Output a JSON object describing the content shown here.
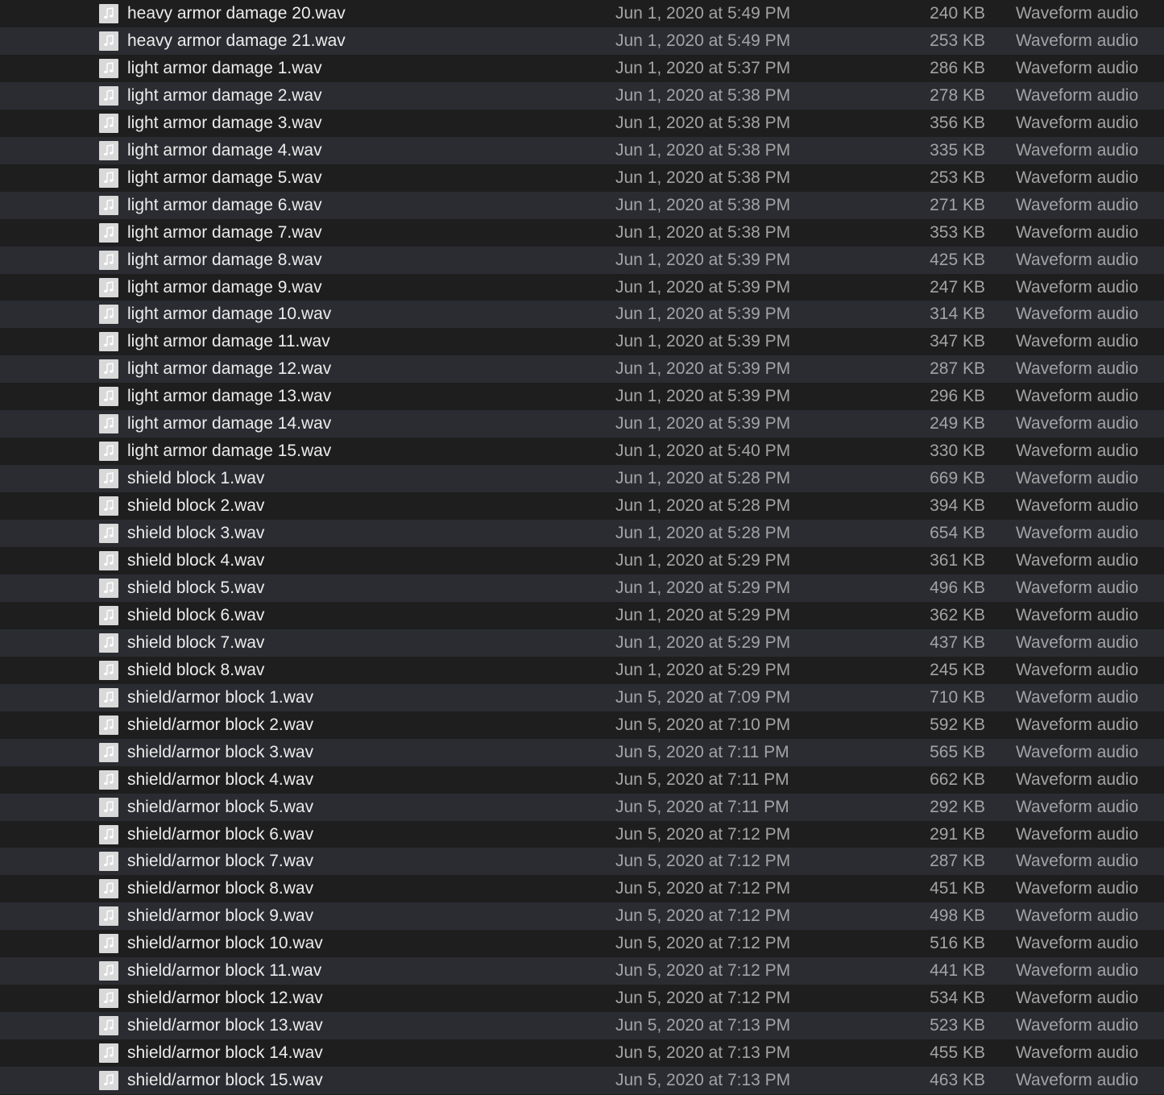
{
  "files": [
    {
      "name": "heavy armor damage 20.wav",
      "date": "Jun 1, 2020 at 5:49 PM",
      "size": "240 KB",
      "kind": "Waveform audio"
    },
    {
      "name": "heavy armor damage 21.wav",
      "date": "Jun 1, 2020 at 5:49 PM",
      "size": "253 KB",
      "kind": "Waveform audio"
    },
    {
      "name": "light armor damage 1.wav",
      "date": "Jun 1, 2020 at 5:37 PM",
      "size": "286 KB",
      "kind": "Waveform audio"
    },
    {
      "name": "light armor damage 2.wav",
      "date": "Jun 1, 2020 at 5:38 PM",
      "size": "278 KB",
      "kind": "Waveform audio"
    },
    {
      "name": "light armor damage 3.wav",
      "date": "Jun 1, 2020 at 5:38 PM",
      "size": "356 KB",
      "kind": "Waveform audio"
    },
    {
      "name": "light armor damage 4.wav",
      "date": "Jun 1, 2020 at 5:38 PM",
      "size": "335 KB",
      "kind": "Waveform audio"
    },
    {
      "name": "light armor damage 5.wav",
      "date": "Jun 1, 2020 at 5:38 PM",
      "size": "253 KB",
      "kind": "Waveform audio"
    },
    {
      "name": "light armor damage 6.wav",
      "date": "Jun 1, 2020 at 5:38 PM",
      "size": "271 KB",
      "kind": "Waveform audio"
    },
    {
      "name": "light armor damage 7.wav",
      "date": "Jun 1, 2020 at 5:38 PM",
      "size": "353 KB",
      "kind": "Waveform audio"
    },
    {
      "name": "light armor damage 8.wav",
      "date": "Jun 1, 2020 at 5:39 PM",
      "size": "425 KB",
      "kind": "Waveform audio"
    },
    {
      "name": "light armor damage 9.wav",
      "date": "Jun 1, 2020 at 5:39 PM",
      "size": "247 KB",
      "kind": "Waveform audio"
    },
    {
      "name": "light armor damage 10.wav",
      "date": "Jun 1, 2020 at 5:39 PM",
      "size": "314 KB",
      "kind": "Waveform audio"
    },
    {
      "name": "light armor damage 11.wav",
      "date": "Jun 1, 2020 at 5:39 PM",
      "size": "347 KB",
      "kind": "Waveform audio"
    },
    {
      "name": "light armor damage 12.wav",
      "date": "Jun 1, 2020 at 5:39 PM",
      "size": "287 KB",
      "kind": "Waveform audio"
    },
    {
      "name": "light armor damage 13.wav",
      "date": "Jun 1, 2020 at 5:39 PM",
      "size": "296 KB",
      "kind": "Waveform audio"
    },
    {
      "name": "light armor damage 14.wav",
      "date": "Jun 1, 2020 at 5:39 PM",
      "size": "249 KB",
      "kind": "Waveform audio"
    },
    {
      "name": "light armor damage 15.wav",
      "date": "Jun 1, 2020 at 5:40 PM",
      "size": "330 KB",
      "kind": "Waveform audio"
    },
    {
      "name": "shield block 1.wav",
      "date": "Jun 1, 2020 at 5:28 PM",
      "size": "669 KB",
      "kind": "Waveform audio"
    },
    {
      "name": "shield block 2.wav",
      "date": "Jun 1, 2020 at 5:28 PM",
      "size": "394 KB",
      "kind": "Waveform audio"
    },
    {
      "name": "shield block 3.wav",
      "date": "Jun 1, 2020 at 5:28 PM",
      "size": "654 KB",
      "kind": "Waveform audio"
    },
    {
      "name": "shield block 4.wav",
      "date": "Jun 1, 2020 at 5:29 PM",
      "size": "361 KB",
      "kind": "Waveform audio"
    },
    {
      "name": "shield block 5.wav",
      "date": "Jun 1, 2020 at 5:29 PM",
      "size": "496 KB",
      "kind": "Waveform audio"
    },
    {
      "name": "shield block 6.wav",
      "date": "Jun 1, 2020 at 5:29 PM",
      "size": "362 KB",
      "kind": "Waveform audio"
    },
    {
      "name": "shield block 7.wav",
      "date": "Jun 1, 2020 at 5:29 PM",
      "size": "437 KB",
      "kind": "Waveform audio"
    },
    {
      "name": "shield block 8.wav",
      "date": "Jun 1, 2020 at 5:29 PM",
      "size": "245 KB",
      "kind": "Waveform audio"
    },
    {
      "name": "shield/armor block 1.wav",
      "date": "Jun 5, 2020 at 7:09 PM",
      "size": "710 KB",
      "kind": "Waveform audio"
    },
    {
      "name": "shield/armor block 2.wav",
      "date": "Jun 5, 2020 at 7:10 PM",
      "size": "592 KB",
      "kind": "Waveform audio"
    },
    {
      "name": "shield/armor block 3.wav",
      "date": "Jun 5, 2020 at 7:11 PM",
      "size": "565 KB",
      "kind": "Waveform audio"
    },
    {
      "name": "shield/armor block 4.wav",
      "date": "Jun 5, 2020 at 7:11 PM",
      "size": "662 KB",
      "kind": "Waveform audio"
    },
    {
      "name": "shield/armor block 5.wav",
      "date": "Jun 5, 2020 at 7:11 PM",
      "size": "292 KB",
      "kind": "Waveform audio"
    },
    {
      "name": "shield/armor block 6.wav",
      "date": "Jun 5, 2020 at 7:12 PM",
      "size": "291 KB",
      "kind": "Waveform audio"
    },
    {
      "name": "shield/armor block 7.wav",
      "date": "Jun 5, 2020 at 7:12 PM",
      "size": "287 KB",
      "kind": "Waveform audio"
    },
    {
      "name": "shield/armor block 8.wav",
      "date": "Jun 5, 2020 at 7:12 PM",
      "size": "451 KB",
      "kind": "Waveform audio"
    },
    {
      "name": "shield/armor block 9.wav",
      "date": "Jun 5, 2020 at 7:12 PM",
      "size": "498 KB",
      "kind": "Waveform audio"
    },
    {
      "name": "shield/armor block 10.wav",
      "date": "Jun 5, 2020 at 7:12 PM",
      "size": "516 KB",
      "kind": "Waveform audio"
    },
    {
      "name": "shield/armor block 11.wav",
      "date": "Jun 5, 2020 at 7:12 PM",
      "size": "441 KB",
      "kind": "Waveform audio"
    },
    {
      "name": "shield/armor block 12.wav",
      "date": "Jun 5, 2020 at 7:12 PM",
      "size": "534 KB",
      "kind": "Waveform audio"
    },
    {
      "name": "shield/armor block 13.wav",
      "date": "Jun 5, 2020 at 7:13 PM",
      "size": "523 KB",
      "kind": "Waveform audio"
    },
    {
      "name": "shield/armor block 14.wav",
      "date": "Jun 5, 2020 at 7:13 PM",
      "size": "455 KB",
      "kind": "Waveform audio"
    },
    {
      "name": "shield/armor block 15.wav",
      "date": "Jun 5, 2020 at 7:13 PM",
      "size": "463 KB",
      "kind": "Waveform audio"
    }
  ],
  "icon": "audio-file-icon",
  "colors": {
    "row_background": "#1e1e1e",
    "row_alternate_background": "#2a2c31",
    "name_text": "#ececec",
    "secondary_text": "#a3a3a5",
    "icon_background": "#d9d9d9"
  }
}
